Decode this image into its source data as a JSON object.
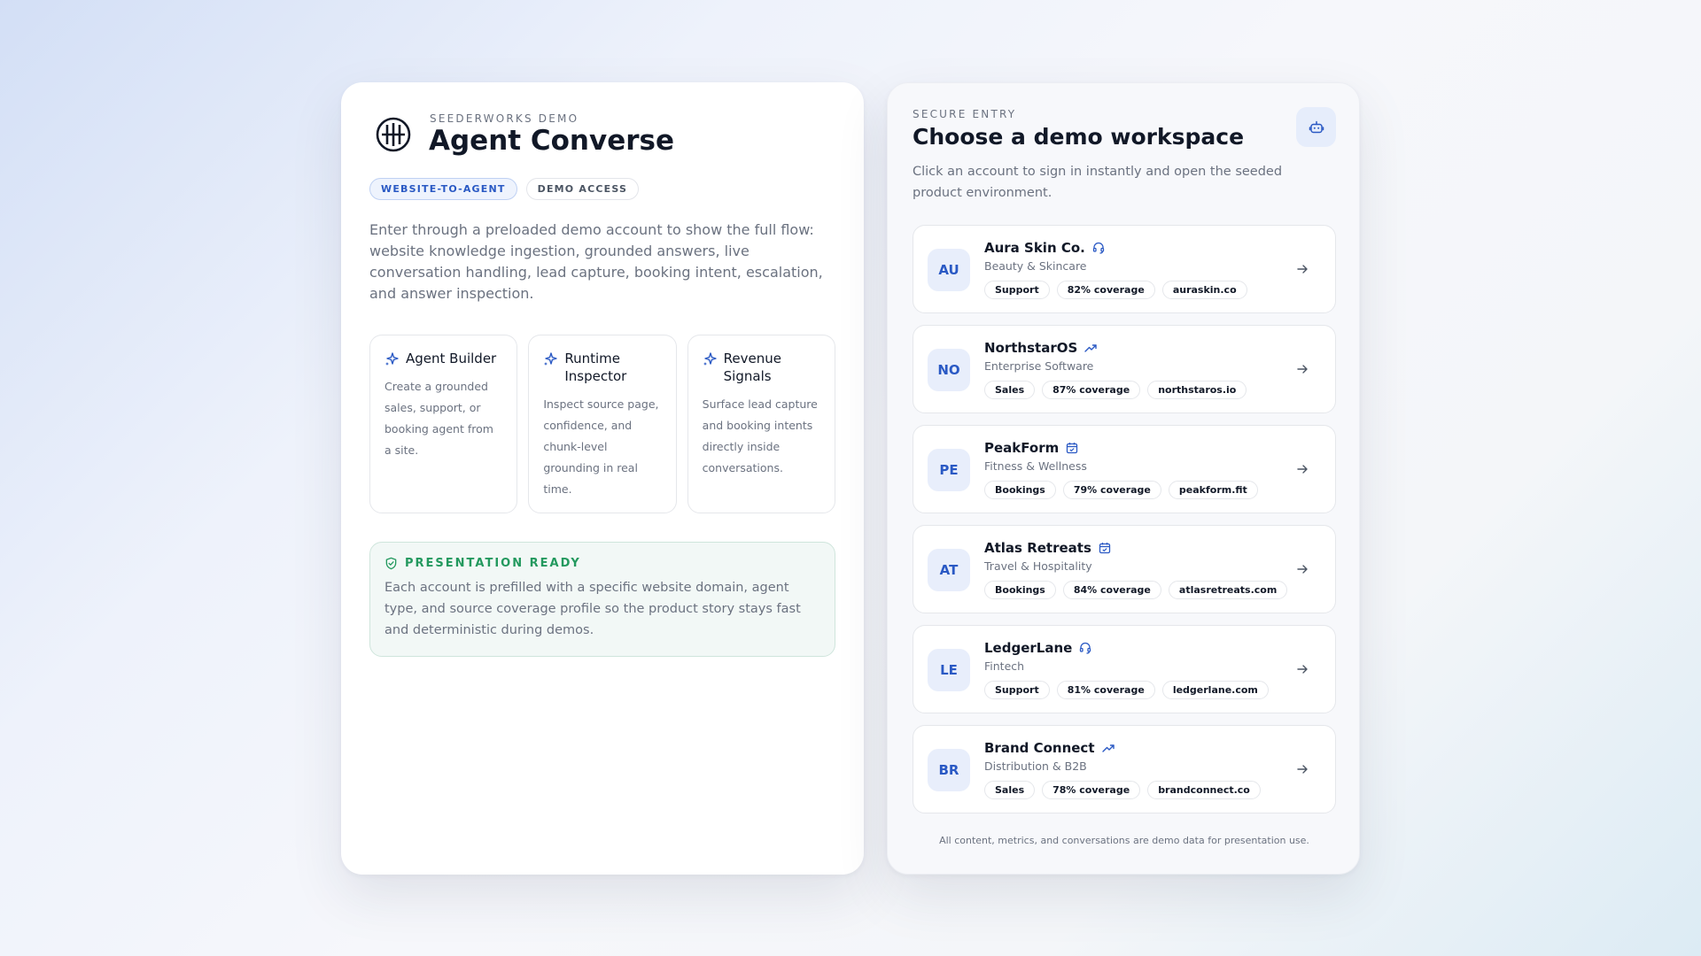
{
  "brand": {
    "eyebrow": "SEEDERWORKS DEMO",
    "title": "Agent Converse",
    "pills": [
      "WEBSITE-TO-AGENT",
      "DEMO ACCESS"
    ],
    "intro": "Enter through a preloaded demo account to show the full flow: website knowledge ingestion, grounded answers, live conversation handling, lead capture, booking intent, escalation, and answer inspection."
  },
  "features": [
    {
      "icon": "sparkle-icon",
      "title": "Agent Builder",
      "desc": "Create a grounded sales, support, or booking agent from a site."
    },
    {
      "icon": "sparkle-icon",
      "title": "Runtime Inspector",
      "desc": "Inspect source page, confidence, and chunk-level grounding in real time."
    },
    {
      "icon": "sparkle-icon",
      "title": "Revenue Signals",
      "desc": "Surface lead capture and booking intents directly inside conversations."
    }
  ],
  "ready": {
    "icon": "shield-check-icon",
    "title": "PRESENTATION READY",
    "desc": "Each account is prefilled with a specific website domain, agent type, and source coverage profile so the product story stays fast and deterministic during demos."
  },
  "entry": {
    "eyebrow": "SECURE ENTRY",
    "title": "Choose a demo workspace",
    "desc": "Click an account to sign in instantly and open the seeded product environment.",
    "icon": "bot-icon"
  },
  "accounts": [
    {
      "initials": "AU",
      "name": "Aura Skin Co.",
      "icon": "headset-icon",
      "industry": "Beauty & Skincare",
      "type": "Support",
      "coverage": "82% coverage",
      "domain": "auraskin.co"
    },
    {
      "initials": "NO",
      "name": "NorthstarOS",
      "icon": "trending-up-icon",
      "industry": "Enterprise Software",
      "type": "Sales",
      "coverage": "87% coverage",
      "domain": "northstaros.io"
    },
    {
      "initials": "PE",
      "name": "PeakForm",
      "icon": "calendar-icon",
      "industry": "Fitness & Wellness",
      "type": "Bookings",
      "coverage": "79% coverage",
      "domain": "peakform.fit"
    },
    {
      "initials": "AT",
      "name": "Atlas Retreats",
      "icon": "calendar-icon",
      "industry": "Travel & Hospitality",
      "type": "Bookings",
      "coverage": "84% coverage",
      "domain": "atlasretreats.com"
    },
    {
      "initials": "LE",
      "name": "LedgerLane",
      "icon": "headset-icon",
      "industry": "Fintech",
      "type": "Support",
      "coverage": "81% coverage",
      "domain": "ledgerlane.com"
    },
    {
      "initials": "BR",
      "name": "Brand Connect",
      "icon": "trending-up-icon",
      "industry": "Distribution & B2B",
      "type": "Sales",
      "coverage": "78% coverage",
      "domain": "brandconnect.co"
    }
  ],
  "footer": "All content, metrics, and conversations are demo data for presentation use.",
  "colors": {
    "accent": "#2a59c4",
    "success": "#23995e",
    "muted": "#6b7280"
  }
}
